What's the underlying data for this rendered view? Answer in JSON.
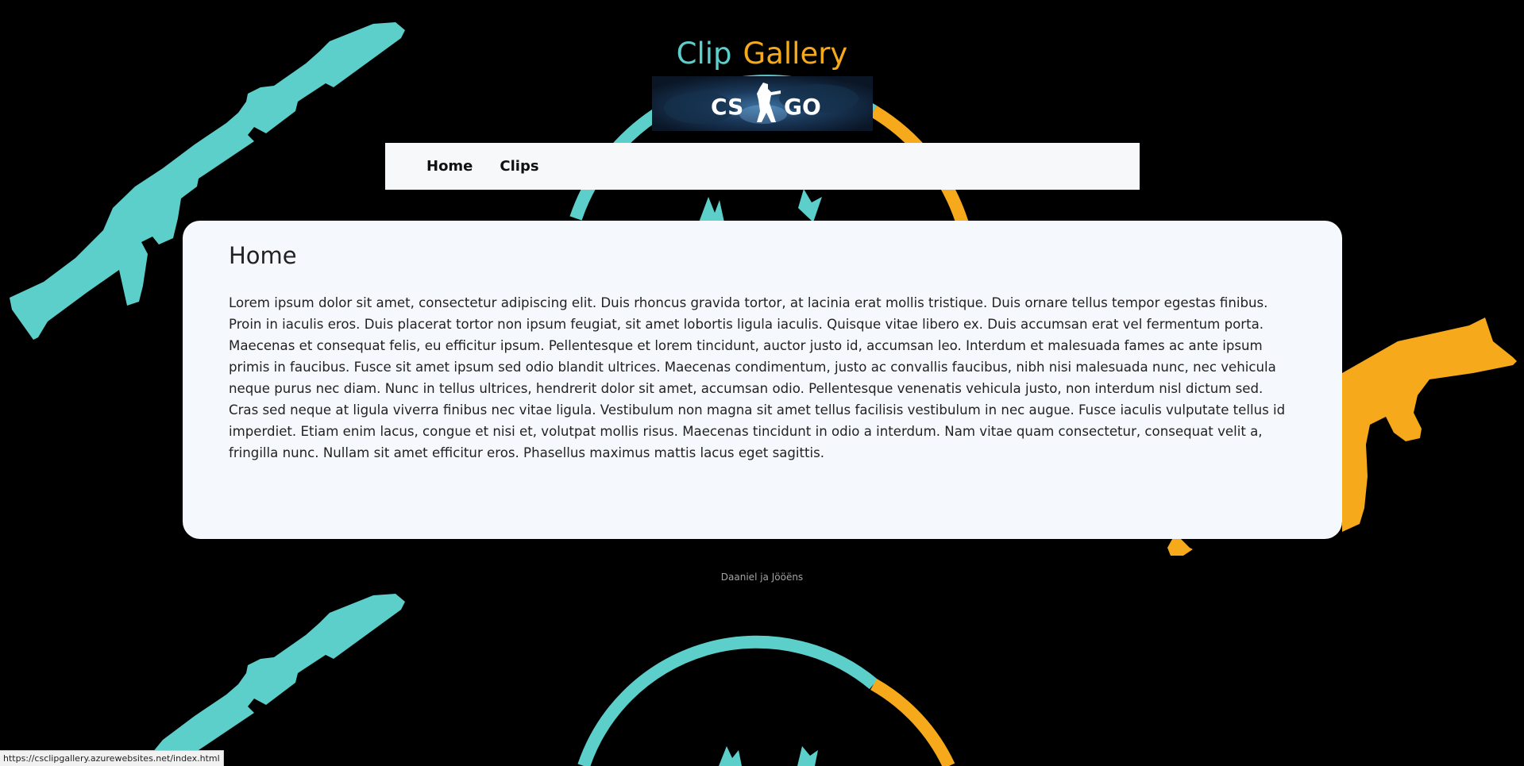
{
  "header": {
    "title_part1": "Clip",
    "title_part2": "Gallery",
    "banner_text": "CS GO"
  },
  "nav": {
    "items": [
      {
        "label": "Home"
      },
      {
        "label": "Clips"
      }
    ]
  },
  "main": {
    "heading": "Home",
    "body": "Lorem ipsum dolor sit amet, consectetur adipiscing elit. Duis rhoncus gravida tortor, at lacinia erat mollis tristique. Duis ornare tellus tempor egestas finibus. Proin in iaculis eros. Duis placerat tortor non ipsum feugiat, sit amet lobortis ligula iaculis. Quisque vitae libero ex. Duis accumsan erat vel fermentum porta. Maecenas et consequat felis, eu efficitur ipsum. Pellentesque et lorem tincidunt, auctor justo id, accumsan leo. Interdum et malesuada fames ac ante ipsum primis in faucibus. Fusce sit amet ipsum sed odio blandit ultrices. Maecenas condimentum, justo ac convallis faucibus, nibh nisi malesuada nunc, nec vehicula neque purus nec diam. Nunc in tellus ultrices, hendrerit dolor sit amet, accumsan odio. Pellentesque venenatis vehicula justo, non interdum nisl dictum sed. Cras sed neque at ligula viverra finibus nec vitae ligula. Vestibulum non magna sit amet tellus facilisis vestibulum in nec augue. Fusce iaculis vulputate tellus id imperdiet. Etiam enim lacus, congue et nisi et, volutpat mollis risus. Maecenas tincidunt in odio a interdum. Nam vitae quam consectetur, consequat velit a, fringilla nunc. Nullam sit amet efficitur eros. Phasellus maximus mattis lacus eget sagittis."
  },
  "footer": {
    "text": "Daaniel ja Jööëns"
  },
  "status_bar": {
    "url": "https://csclipgallery.azurewebsites.net/index.html"
  },
  "colors": {
    "background": "#000000",
    "teal": "#5ccfcb",
    "orange": "#f6a91a",
    "card": "#f5f8fc",
    "nav": "#f7f8fa"
  },
  "icons": [
    "rifle-m4-icon",
    "rifle-ak-icon",
    "cs-emblem-icon"
  ]
}
